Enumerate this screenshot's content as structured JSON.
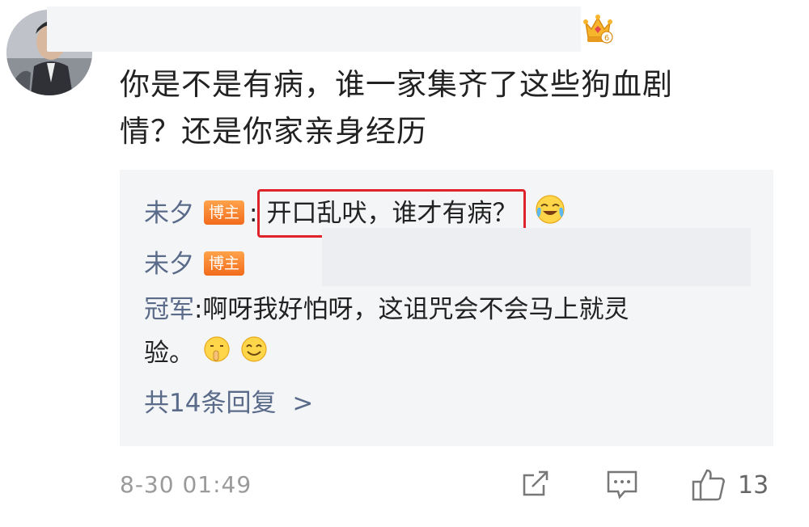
{
  "post": {
    "text_line1": "你是不是有病，谁一家集齐了这些狗血剧",
    "text_line2": "情？还是你家亲身经历"
  },
  "replies": {
    "reply1": {
      "user": "未夕",
      "badge": "博主",
      "colon": ":",
      "text": "开口乱吠，谁才有病？"
    },
    "reply2": {
      "user": "未夕",
      "badge": "博主"
    },
    "reply3": {
      "user": "冠军",
      "colon": ":",
      "text1": "啊呀我好怕呀，这诅咒会不会马上就灵",
      "text2": "验。"
    },
    "more": "共14条回复",
    "more_chevron": ">"
  },
  "footer": {
    "time": "8-30 01:49",
    "likes": "13"
  },
  "icons": [
    "crown-icon",
    "crying-laugh-emoji",
    "shush-emoji",
    "smile-emoji",
    "share-icon",
    "comment-icon",
    "like-icon"
  ],
  "colors": {
    "username": "#5a6b8a",
    "highlight_border": "#e0222a",
    "badge": "#f26b1c"
  }
}
